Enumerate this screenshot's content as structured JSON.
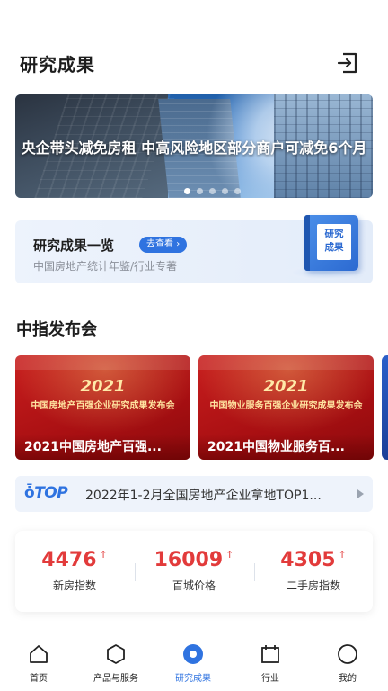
{
  "header": {
    "title": "研究成果",
    "exit_icon": "exit-icon"
  },
  "banner": {
    "caption": "央企带头减免房租 中高风险地区部分商户可减免6个月",
    "slide_count": 5,
    "active_slide": 1
  },
  "catalog": {
    "title": "研究成果一览",
    "go_label": "去查看",
    "subtitle": "中国房地产统计年鉴/行业专著",
    "book_label": "研究成果"
  },
  "events_section": {
    "title": "中指发布会",
    "items": [
      {
        "year": "2021",
        "name": "中国房地产百强企业研究成果发布会",
        "caption": "2021中国房地产百强..."
      },
      {
        "year": "2021",
        "name": "中国物业服务百强企业研究成果发布会",
        "caption": "2021中国物业服务百..."
      }
    ]
  },
  "ticker": {
    "tag": "TOP",
    "text": "2022年1-2月全国房地产企业拿地TOP1..."
  },
  "indices": [
    {
      "value": "4476",
      "label": "新房指数",
      "trend": "↑"
    },
    {
      "value": "16009",
      "label": "百城价格",
      "trend": "↑"
    },
    {
      "value": "4305",
      "label": "二手房指数",
      "trend": "↑"
    }
  ],
  "tabbar": {
    "items": [
      {
        "label": "首页",
        "icon": "home-icon"
      },
      {
        "label": "产品与服务",
        "icon": "hexagon-icon"
      },
      {
        "label": "研究成果",
        "icon": "research-icon"
      },
      {
        "label": "行业",
        "icon": "calendar-icon"
      },
      {
        "label": "我的",
        "icon": "profile-icon"
      }
    ],
    "active_index": 2
  },
  "colors": {
    "accent": "#2f73e0",
    "index_red": "#e23b3b",
    "event_red": "#b8161a"
  }
}
